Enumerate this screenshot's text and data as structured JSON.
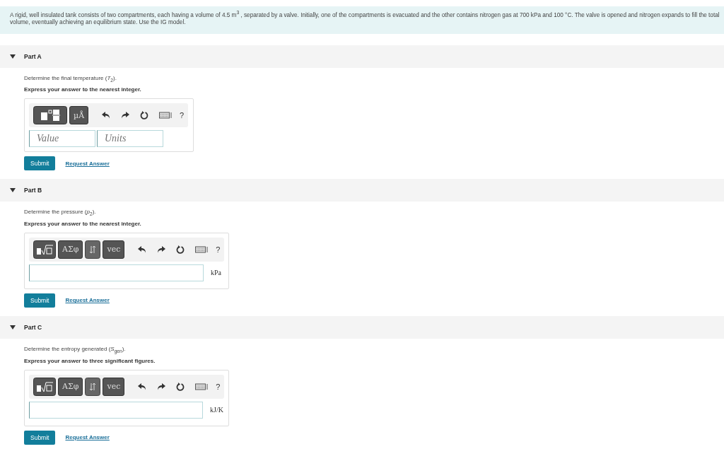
{
  "intro": "A rigid, well insulated tank consists of two compartments, each having a volume of 4.5 m$^{3}$ , separated by a valve. Initially, one of the compartments is evacuated and the other contains nitrogen gas at 700 kPa and 100 °C. The valve is opened and nitrogen expands to fill the total volume, eventually achieving an equilibrium state. Use the IG model.",
  "parts": [
    {
      "title": "Part A",
      "expanded": true,
      "prompt": "Determine the final temperature (*T*$_{2}$).",
      "instruction": "Express your answer to the nearest integer.",
      "toolbar": [
        {
          "kind": "template"
        },
        {
          "kind": "label",
          "label": "µÅ"
        }
      ],
      "help": "?",
      "fields": [
        {
          "placeholder": "Value"
        },
        {
          "placeholder": "Units"
        }
      ],
      "submit": "Submit",
      "request": "Request Answer"
    },
    {
      "title": "Part B",
      "expanded": true,
      "prompt": "Determine the pressure (*p*$_{2}$).",
      "instruction": "Express your answer to the nearest integer.",
      "toolbar": [
        {
          "kind": "root"
        },
        {
          "kind": "label",
          "label": "ΑΣφ"
        },
        {
          "kind": "arrows"
        },
        {
          "kind": "label",
          "label": "vec"
        }
      ],
      "help": "?",
      "unit": "kPa",
      "submit": "Submit",
      "request": "Request Answer"
    },
    {
      "title": "Part C",
      "expanded": true,
      "prompt": "Determine the entropy generated (*S*$_{gen}$).",
      "instruction": "Express your answer to three significant figures.",
      "toolbar": [
        {
          "kind": "root"
        },
        {
          "kind": "label",
          "label": "ΑΣφ"
        },
        {
          "kind": "arrows"
        },
        {
          "kind": "label",
          "label": "vec"
        }
      ],
      "help": "?",
      "unit": "kJ/K",
      "submit": "Submit",
      "request": "Request Answer"
    }
  ]
}
